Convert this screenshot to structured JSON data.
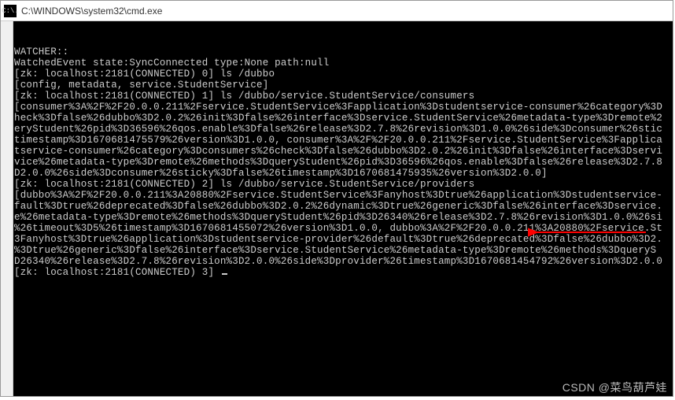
{
  "titlebar": {
    "icon_text": "C:\\.",
    "title": "C:\\WINDOWS\\system32\\cmd.exe"
  },
  "terminal": {
    "lines": [
      "",
      "WATCHER::",
      "",
      "WatchedEvent state:SyncConnected type:None path:null",
      "[zk: localhost:2181(CONNECTED) 0] ls /dubbo",
      "[config, metadata, service.StudentService]",
      "[zk: localhost:2181(CONNECTED) 1] ls /dubbo/service.StudentService/consumers",
      "[consumer%3A%2F%2F20.0.0.211%2Fservice.StudentService%3Fapplication%3Dstudentservice-consumer%26category%3D",
      "heck%3Dfalse%26dubbo%3D2.0.2%26init%3Dfalse%26interface%3Dservice.StudentService%26metadata-type%3Dremote%2",
      "eryStudent%26pid%3D36596%26qos.enable%3Dfalse%26release%3D2.7.8%26revision%3D1.0.0%26side%3Dconsumer%26stic",
      "timestamp%3D1670681475579%26version%3D1.0.0, consumer%3A%2F%2F20.0.0.211%2Fservice.StudentService%3Fapplica",
      "tservice-consumer%26category%3Dconsumers%26check%3Dfalse%26dubbo%3D2.0.2%26init%3Dfalse%26interface%3Dservi",
      "vice%26metadata-type%3Dremote%26methods%3DqueryStudent%26pid%3D36596%26qos.enable%3Dfalse%26release%3D2.7.8",
      "D2.0.0%26side%3Dconsumer%26sticky%3Dfalse%26timestamp%3D1670681475935%26version%3D2.0.0]",
      "[zk: localhost:2181(CONNECTED) 2] ls /dubbo/service.StudentService/providers",
      "[dubbo%3A%2F%2F20.0.0.211%3A20880%2Fservice.StudentService%3Fanyhost%3Dtrue%26application%3Dstudentservice-",
      "fault%3Dtrue%26deprecated%3Dfalse%26dubbo%3D2.0.2%26dynamic%3Dtrue%26generic%3Dfalse%26interface%3Dservice.",
      "e%26metadata-type%3Dremote%26methods%3DqueryStudent%26pid%3D26340%26release%3D2.7.8%26revision%3D1.0.0%26si",
      "%26timeout%3D5%26timestamp%3D1670681455072%26version%3D1.0.0, dubbo%3A%2F%2F20.0.0.211%3A20880%2Fservice.St",
      "3Fanyhost%3Dtrue%26application%3Dstudentservice-provider%26default%3Dtrue%26deprecated%3Dfalse%26dubbo%3D2.",
      "%3Dtrue%26generic%3Dfalse%26interface%3Dservice.StudentService%26metadata-type%3Dremote%26methods%3DqueryS",
      "D26340%26release%3D2.7.8%26revision%3D2.0.0%26side%3Dprovider%26timestamp%3D1670681454792%26version%3D2.0.0",
      "[zk: localhost:2181(CONNECTED) 3] "
    ]
  },
  "annotation_arrow": {
    "color": "#ff0000"
  },
  "watermark": {
    "text": "CSDN @菜鸟葫芦娃"
  }
}
